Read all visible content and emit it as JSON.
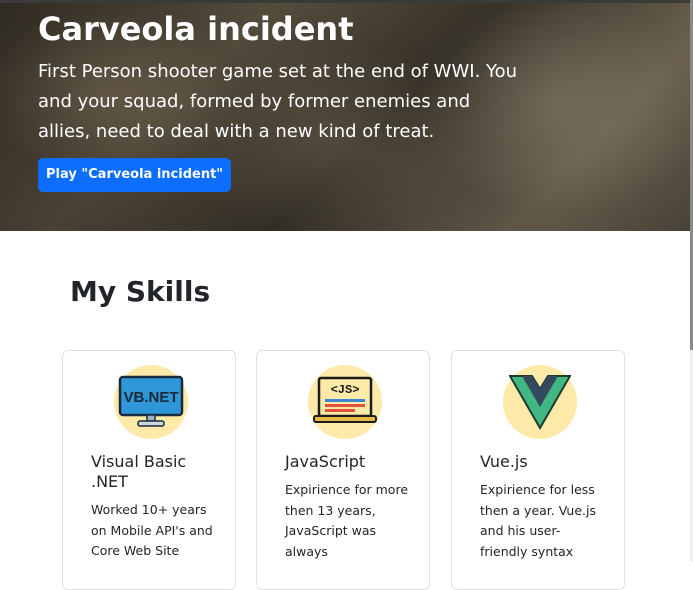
{
  "hero": {
    "title": "Carveola incident",
    "description": "First Person shooter game set at the end of WWI. You and your squad, formed by former enemies and allies, need to deal with a new kind of treat.",
    "play_button": "Play \"Carveola incident\""
  },
  "skills": {
    "heading": "My Skills",
    "cards": [
      {
        "title": "Visual Basic .NET",
        "icon": "vbnet-monitor-icon",
        "icon_text": "VB.NET",
        "text": "Worked 10+ years on Mobile API's and Core Web Site"
      },
      {
        "title": "JavaScript",
        "icon": "javascript-laptop-icon",
        "icon_text": "<JS>",
        "text": "Expirience for more then 13 years, JavaScript was always"
      },
      {
        "title": "Vue.js",
        "icon": "vue-logo-icon",
        "text": "Expirience for less then a year. Vue.js and his user-friendly syntax"
      }
    ]
  },
  "colors": {
    "primary": "#0d6efd",
    "icon_background": "#fde9a8",
    "vue_green": "#41b883",
    "vue_dark": "#35495e"
  }
}
